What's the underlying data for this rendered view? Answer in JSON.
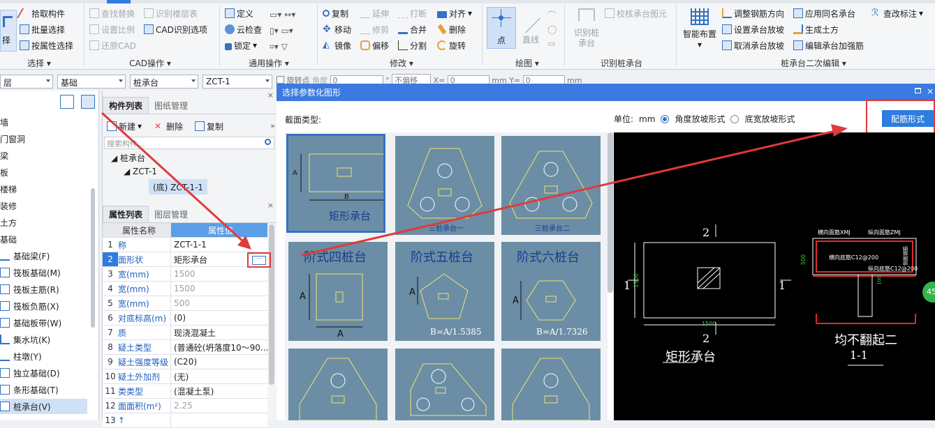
{
  "ribbon": {
    "group1": {
      "items": [
        "拾取构件",
        "批量选择",
        "按属性选择"
      ],
      "partial": "择",
      "label": "选择"
    },
    "group2": {
      "items": [
        "查找替换",
        "识别楼层表",
        "设置比例",
        "CAD识别选项",
        "还原CAD"
      ],
      "label": "CAD操作"
    },
    "group3": {
      "items": [
        "定义",
        "云检查",
        "锁定"
      ],
      "label": "通用操作"
    },
    "group4": {
      "items": [
        "复制",
        "延伸",
        "打断",
        "对齐",
        "移动",
        "修剪",
        "合并",
        "删除",
        "镜像",
        "偏移",
        "分割",
        "旋转"
      ],
      "label": "修改"
    },
    "group5": {
      "items": [
        "点",
        "直线"
      ],
      "label": "绘图"
    },
    "group6": {
      "items": [
        "识别桩承台",
        "校核承台图元"
      ],
      "label": "识别桩承台"
    },
    "group7": {
      "items": [
        "智能布置",
        "调整钢筋方向",
        "应用同名承台",
        "查改标注",
        "设置承台放坡",
        "生成土方",
        "取消承台放坡",
        "编辑承台加强筋"
      ],
      "label": "桩承台二次编辑"
    }
  },
  "toolbar2": {
    "combos": [
      "层",
      "基础",
      "桩承台",
      "ZCT-1"
    ],
    "extra": [
      "旋转点",
      "角度",
      "0",
      "°",
      "不偏移",
      "X=",
      "0",
      "mm",
      "Y=",
      "0",
      "mm"
    ]
  },
  "leftnav": {
    "items": [
      "墙",
      "门窗洞",
      "梁",
      "板",
      "楼梯",
      "装修",
      "土方",
      "基础",
      "基础梁(F)",
      "筏板基础(M)",
      "筏板主筋(R)",
      "筏板负筋(X)",
      "基础板带(W)",
      "集水坑(K)",
      "柱墩(Y)",
      "独立基础(D)",
      "条形基础(T)",
      "桩承台(V)"
    ]
  },
  "component_panel": {
    "tabs": [
      "构件列表",
      "图纸管理"
    ],
    "actions": [
      "新建",
      "删除",
      "复制"
    ],
    "search_placeholder": "搜索构件...",
    "tree": [
      "桩承台",
      "ZCT-1",
      "(底) ZCT-1-1"
    ]
  },
  "property_panel": {
    "tabs": [
      "属性列表",
      "图层管理"
    ],
    "header_name": "属性名称",
    "header_value": "属性值",
    "rows": [
      {
        "n": "1",
        "k": "称",
        "v": "ZCT-1-1"
      },
      {
        "n": "2",
        "k": "面形状",
        "v": "矩形承台"
      },
      {
        "n": "3",
        "k": "宽(mm)",
        "v": "1500"
      },
      {
        "n": "4",
        "k": "宽(mm)",
        "v": "1500"
      },
      {
        "n": "5",
        "k": "宽(mm)",
        "v": "500"
      },
      {
        "n": "6",
        "k": "对底标高(m)",
        "v": "(0)"
      },
      {
        "n": "7",
        "k": "质",
        "v": "现浇混凝土"
      },
      {
        "n": "8",
        "k": "疑土类型",
        "v": "(普通砼(坍落度10～90..."
      },
      {
        "n": "9",
        "k": "疑土强度等级",
        "v": "(C20)"
      },
      {
        "n": "10",
        "k": "疑土外加剂",
        "v": "(无)"
      },
      {
        "n": "11",
        "k": "类类型",
        "v": "(混凝土泵)"
      },
      {
        "n": "12",
        "k": "面面积(m²)",
        "v": "2.25"
      },
      {
        "n": "13",
        "k": "↑",
        "v": ""
      }
    ]
  },
  "dialog": {
    "title": "选择参数化图形",
    "section_label": "截面类型:",
    "unit_label": "单位:",
    "unit": "mm",
    "radio1": "角度放坡形式",
    "radio2": "底宽放坡形式",
    "button": "配筋形式",
    "thumbs": [
      {
        "label": "矩形承台",
        "sub": ""
      },
      {
        "label": "三桩承台一",
        "sub": ""
      },
      {
        "label": "三桩承台二",
        "sub": ""
      },
      {
        "label": "阶式四桩台",
        "sub": ""
      },
      {
        "label": "阶式五桩台",
        "sub": "B=A/1.5385"
      },
      {
        "label": "阶式六桩台",
        "sub": "B=A/1.7326"
      },
      {
        "label": "",
        "sub": ""
      },
      {
        "label": "",
        "sub": ""
      },
      {
        "label": "",
        "sub": ""
      }
    ],
    "preview": {
      "plan_title": "矩形承台",
      "section_title": "均不翻起二",
      "section_id": "1-1",
      "mark2": "2",
      "mark1": "1",
      "dim": "1500",
      "h": "500",
      "labels": [
        "横向面筋XMJ",
        "纵向面筋ZMJ",
        "横向底筋C12@200",
        "纵向底筋C12@200",
        "侧面钢筋",
        "100"
      ],
      "badge": "45"
    }
  },
  "colors": {
    "accent": "#2d7de0",
    "annotation": "#e03a3a",
    "thumb_bg": "#6b8ea6",
    "cad_bg": "#000000"
  }
}
